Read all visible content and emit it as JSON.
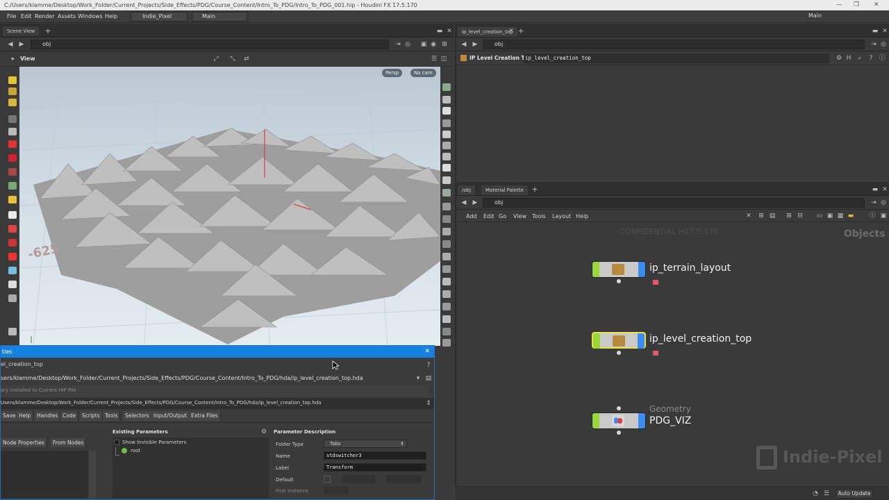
{
  "window": {
    "title": "C:/Users/klamme/Desktop/Work_Folder/Current_Projects/Side_Effects/PDG/Course_Content/Intro_To_PDG/Intro_To_PDG_001.hip - Houdini FX 17.5.170"
  },
  "menu": {
    "items": [
      "File",
      "Edit",
      "Render",
      "Assets",
      "Windows",
      "Help"
    ],
    "shelf_set": "Indie_Pixel",
    "desktop": "Main",
    "right_desktop": "Main"
  },
  "scene_view": {
    "tab_label": "Scene View",
    "path": "obj",
    "view_label": "View",
    "persp_btn": "Persp",
    "cam_btn": "No cam",
    "grid_number": "-625"
  },
  "param_pane": {
    "tab_label": "ip_level_creation_top",
    "path": "obj",
    "node_type": "IP Level Creation Top",
    "node_name": "ip_level_creation_top"
  },
  "network_pane": {
    "tabs": [
      "/obj",
      "Material Palette"
    ],
    "path": "obj",
    "menu": [
      "Add",
      "Edit",
      "Go",
      "View",
      "Tools",
      "Layout",
      "Help"
    ],
    "watermark": "CONFIDENTIAL H17.5.170",
    "context_label": "Objects",
    "nodes": [
      {
        "name": "ip_terrain_layout",
        "subtitle": ""
      },
      {
        "name": "ip_level_creation_top",
        "subtitle": ""
      },
      {
        "name": "PDG_VIZ",
        "subtitle": "Geometry"
      }
    ],
    "brand": "Indie-Pixel",
    "auto_update": "Auto Update"
  },
  "properties_window": {
    "title": "ties",
    "operator": "el_creation_top",
    "library_path": "sers/klamme/Desktop/Work_Folder/Current_Projects/Side_Effects/PDG/Course_Content/Intro_To_PDG/hda/ip_level_creation_top.hda",
    "installed_note": "ary installed to Current HIP File",
    "save_path": "Users/klamme/Desktop/Work_Folder/Current_Projects/Side_Effects/PDG/Course_Content/Intro_To_PDG/hda/ip_level_creation_top.hda",
    "tabs": [
      "Save",
      "Help",
      "Handles",
      "Code",
      "Scripts",
      "Tools",
      "Selectors",
      "Input/Output",
      "Extra Files"
    ],
    "left_buttons": [
      "Node Properties",
      "From Nodes"
    ],
    "existing_params_title": "Existing Parameters",
    "show_invisible": "Show Invisible Parameters",
    "root_label": "root",
    "param_desc_title": "Parameter Description",
    "folder_type_label": "Folder Type",
    "folder_type_value": "Tabs",
    "name_label": "Name",
    "name_value": "stdswitcher3",
    "label_label": "Label",
    "label_value": "Transform",
    "default_label": "Default",
    "first_instance_label": "First Instance"
  },
  "colors": {
    "accent_blue": "#1781e0",
    "node_green": "#9ad83a",
    "node_blue": "#3f8cf0",
    "lock_red": "#e05a6e"
  }
}
